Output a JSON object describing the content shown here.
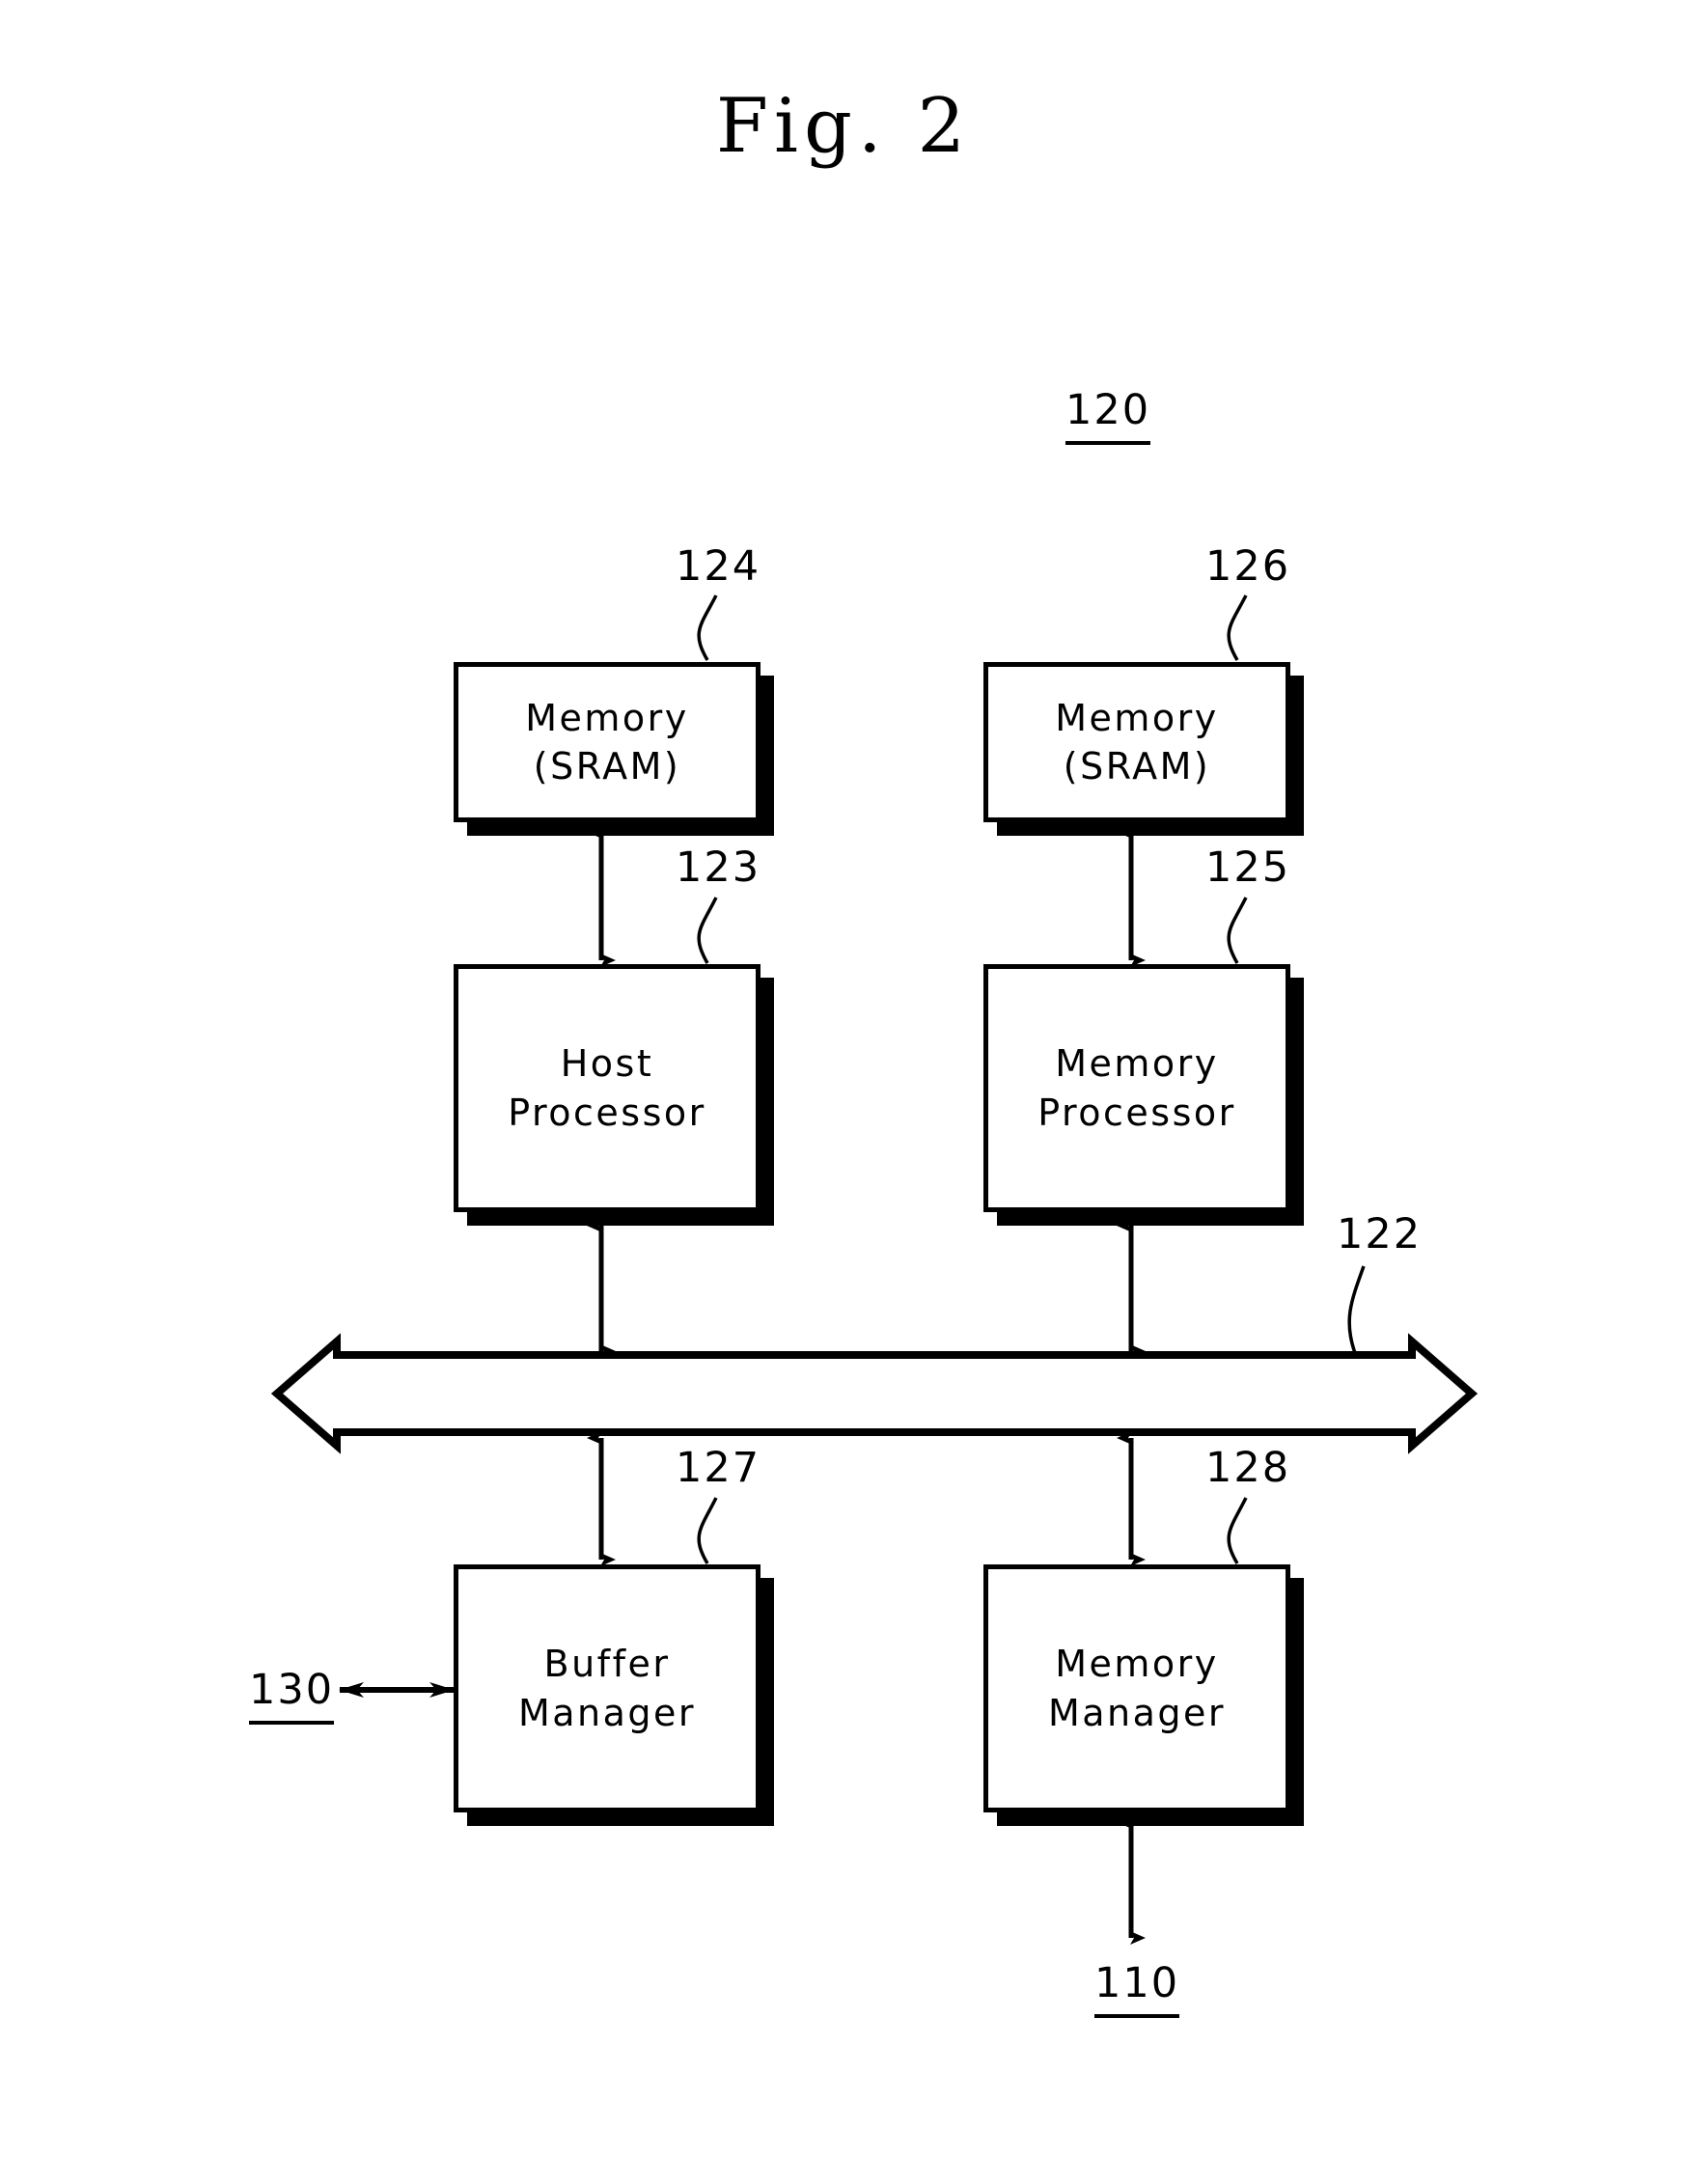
{
  "figure": {
    "title": "Fig. 2",
    "system_ref": "120"
  },
  "nodes": [
    {
      "id": "memory_sram_left",
      "label": "Memory\n(SRAM)",
      "ref": "124"
    },
    {
      "id": "memory_sram_right",
      "label": "Memory\n(SRAM)",
      "ref": "126"
    },
    {
      "id": "host_processor",
      "label": "Host\nProcessor",
      "ref": "123"
    },
    {
      "id": "memory_processor",
      "label": "Memory\nProcessor",
      "ref": "125"
    },
    {
      "id": "buffer_manager",
      "label": "Buffer\nManager",
      "ref": "127"
    },
    {
      "id": "memory_manager",
      "label": "Memory\nManager",
      "ref": "128"
    }
  ],
  "bus": {
    "ref": "122",
    "type": "bidirectional-bus-arrow"
  },
  "external": {
    "host_interface_ref": "130",
    "memory_device_ref": "110"
  },
  "connections": [
    {
      "from": "memory_sram_left",
      "to": "host_processor",
      "style": "double-arrow-vertical"
    },
    {
      "from": "memory_sram_right",
      "to": "memory_processor",
      "style": "double-arrow-vertical"
    },
    {
      "from": "host_processor",
      "to": "bus",
      "style": "double-arrow-vertical"
    },
    {
      "from": "memory_processor",
      "to": "bus",
      "style": "double-arrow-vertical"
    },
    {
      "from": "bus",
      "to": "buffer_manager",
      "style": "double-arrow-vertical"
    },
    {
      "from": "bus",
      "to": "memory_manager",
      "style": "double-arrow-vertical"
    },
    {
      "from": "buffer_manager",
      "to": "130",
      "style": "double-arrow-horizontal"
    },
    {
      "from": "memory_manager",
      "to": "110",
      "style": "double-arrow-vertical"
    }
  ],
  "colors": {
    "stroke": "#000000",
    "fill": "#ffffff"
  }
}
